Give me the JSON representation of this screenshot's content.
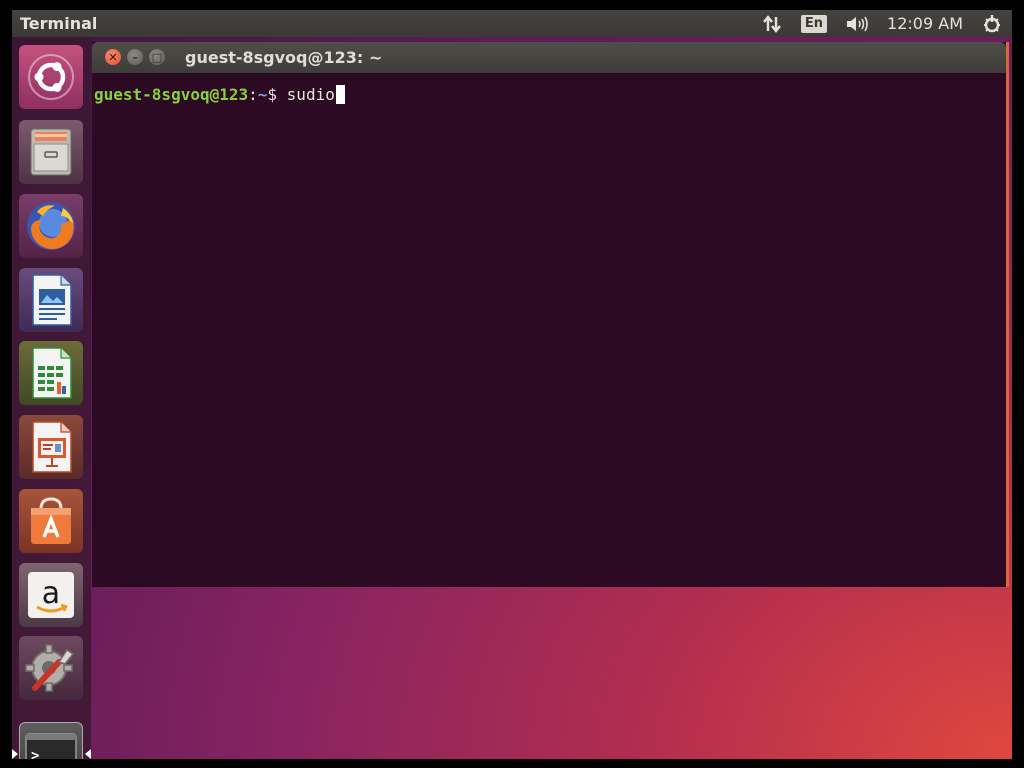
{
  "top_panel": {
    "title": "Terminal",
    "lang": "En",
    "clock": "12:09 AM",
    "icons": [
      "network-arrows-icon",
      "volume-icon",
      "power-gear-icon"
    ]
  },
  "launcher": {
    "items": [
      {
        "name": "dash",
        "icon": "ubuntu-logo-icon"
      },
      {
        "name": "files",
        "icon": "file-cabinet-icon"
      },
      {
        "name": "firefox",
        "icon": "firefox-icon"
      },
      {
        "name": "writer",
        "icon": "libreoffice-writer-icon"
      },
      {
        "name": "calc",
        "icon": "libreoffice-calc-icon"
      },
      {
        "name": "impress",
        "icon": "libreoffice-impress-icon"
      },
      {
        "name": "software",
        "icon": "software-center-bag-icon"
      },
      {
        "name": "amazon",
        "icon": "amazon-icon",
        "glyph": "a"
      },
      {
        "name": "settings",
        "icon": "system-settings-icon"
      },
      {
        "name": "terminal",
        "icon": "terminal-icon",
        "glyph": ">_"
      }
    ]
  },
  "terminal": {
    "window_title": "guest-8sgvoq@123: ~",
    "prompt_user": "guest-8sgvoq@123",
    "prompt_colon": ":",
    "prompt_path": "~",
    "prompt_dollar": "$ ",
    "command": "sudio"
  },
  "colors": {
    "terminal_bg": "#2c0a23",
    "prompt_user": "#87d23c",
    "prompt_path": "#7b9fd4",
    "accent_orange": "#d9653a"
  }
}
